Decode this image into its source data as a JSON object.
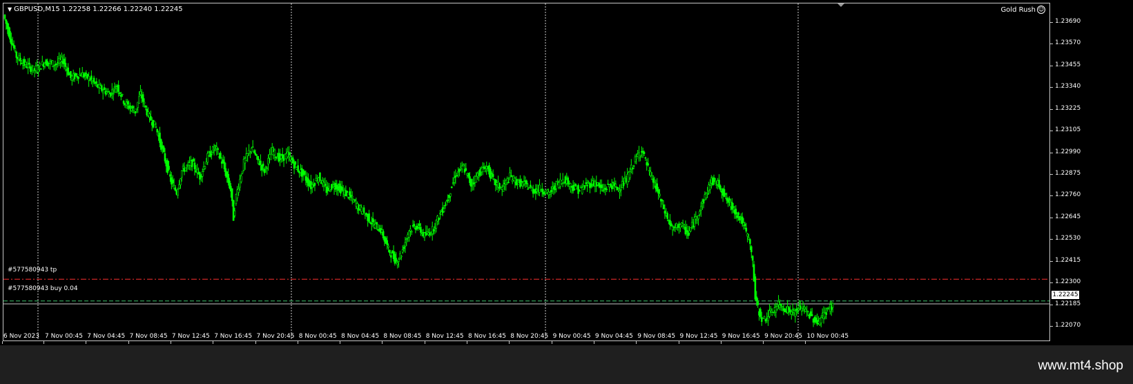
{
  "chart": {
    "symbol_label": "GBPUSD,M15",
    "ohlc_label": "1.22258 1.22266 1.22240 1.22245",
    "indicator_name": "Gold Rush",
    "bid_price": "1.22245",
    "candle_color": "#00ff00",
    "background_color": "#000000"
  },
  "orders": {
    "tp_label": "#577580943 tp",
    "tp_price": 1.2237,
    "tp_line_color": "#ff3030",
    "entry_label": "#577580943 buy 0.04",
    "entry_price": 1.2226,
    "entry_line_color": "#3cbf6a"
  },
  "price_axis": [
    "1.23690",
    "1.23570",
    "1.23455",
    "1.23340",
    "1.23225",
    "1.23105",
    "1.22990",
    "1.22875",
    "1.22760",
    "1.22645",
    "1.22530",
    "1.22415",
    "1.22300",
    "1.22185",
    "1.22070"
  ],
  "time_axis": [
    "6 Nov 2023",
    "7 Nov 00:45",
    "7 Nov 04:45",
    "7 Nov 08:45",
    "7 Nov 12:45",
    "7 Nov 16:45",
    "7 Nov 20:45",
    "8 Nov 00:45",
    "8 Nov 04:45",
    "8 Nov 08:45",
    "8 Nov 12:45",
    "8 Nov 16:45",
    "8 Nov 20:45",
    "9 Nov 00:45",
    "9 Nov 04:45",
    "9 Nov 08:45",
    "9 Nov 12:45",
    "9 Nov 16:45",
    "9 Nov 20:45",
    "10 Nov 00:45"
  ],
  "price_range": [
    1.2207,
    1.2375
  ],
  "day_separators": [
    "7 Nov",
    "8 Nov",
    "9 Nov",
    "10 Nov"
  ],
  "price_path": [
    [
      0,
      1.2371
    ],
    [
      2,
      1.2362
    ],
    [
      5,
      1.235
    ],
    [
      8,
      1.2346
    ],
    [
      12,
      1.2343
    ],
    [
      16,
      1.2347
    ],
    [
      20,
      1.2346
    ],
    [
      23,
      1.2348
    ],
    [
      26,
      1.2339
    ],
    [
      30,
      1.2341
    ],
    [
      33,
      1.2339
    ],
    [
      37,
      1.2334
    ],
    [
      41,
      1.2331
    ],
    [
      44,
      1.2335
    ],
    [
      47,
      1.2326
    ],
    [
      51,
      1.2322
    ],
    [
      53,
      1.2331
    ],
    [
      56,
      1.232
    ],
    [
      59,
      1.2314
    ],
    [
      62,
      1.23
    ],
    [
      65,
      1.2286
    ],
    [
      67,
      1.2281
    ],
    [
      69,
      1.2292
    ],
    [
      73,
      1.2296
    ],
    [
      76,
      1.2289
    ],
    [
      79,
      1.2299
    ],
    [
      82,
      1.2304
    ],
    [
      85,
      1.2295
    ],
    [
      88,
      1.2282
    ],
    [
      89,
      1.2268
    ],
    [
      90,
      1.2279
    ],
    [
      93,
      1.2296
    ],
    [
      96,
      1.2304
    ],
    [
      98,
      1.2298
    ],
    [
      101,
      1.2292
    ],
    [
      104,
      1.2302
    ],
    [
      107,
      1.2298
    ],
    [
      110,
      1.23
    ],
    [
      113,
      1.2294
    ],
    [
      116,
      1.229
    ],
    [
      119,
      1.2284
    ],
    [
      122,
      1.2289
    ],
    [
      125,
      1.2282
    ],
    [
      128,
      1.2285
    ],
    [
      131,
      1.2282
    ],
    [
      134,
      1.2279
    ],
    [
      137,
      1.2274
    ],
    [
      140,
      1.227
    ],
    [
      143,
      1.2265
    ],
    [
      146,
      1.2262
    ],
    [
      149,
      1.2252
    ],
    [
      152,
      1.2246
    ],
    [
      154,
      1.225
    ],
    [
      157,
      1.2262
    ],
    [
      160,
      1.2264
    ],
    [
      163,
      1.2259
    ],
    [
      166,
      1.2262
    ],
    [
      169,
      1.227
    ],
    [
      172,
      1.2278
    ],
    [
      175,
      1.229
    ],
    [
      178,
      1.2294
    ],
    [
      181,
      1.2285
    ],
    [
      184,
      1.2291
    ],
    [
      187,
      1.2294
    ],
    [
      190,
      1.2286
    ],
    [
      193,
      1.2283
    ],
    [
      196,
      1.2289
    ],
    [
      199,
      1.2286
    ],
    [
      202,
      1.2285
    ],
    [
      205,
      1.2282
    ],
    [
      208,
      1.2283
    ],
    [
      211,
      1.228
    ],
    [
      214,
      1.2285
    ],
    [
      217,
      1.2288
    ],
    [
      220,
      1.2284
    ],
    [
      223,
      1.2282
    ],
    [
      226,
      1.2285
    ],
    [
      229,
      1.2286
    ],
    [
      232,
      1.2282
    ],
    [
      235,
      1.2285
    ],
    [
      238,
      1.2283
    ],
    [
      241,
      1.2287
    ],
    [
      244,
      1.2296
    ],
    [
      247,
      1.2303
    ],
    [
      250,
      1.2291
    ],
    [
      253,
      1.2282
    ],
    [
      256,
      1.2271
    ],
    [
      259,
      1.2262
    ],
    [
      262,
      1.2265
    ],
    [
      265,
      1.226
    ],
    [
      268,
      1.2268
    ],
    [
      271,
      1.2277
    ],
    [
      274,
      1.2287
    ],
    [
      277,
      1.2285
    ],
    [
      280,
      1.2277
    ],
    [
      283,
      1.2272
    ],
    [
      286,
      1.2266
    ],
    [
      289,
      1.2255
    ],
    [
      290,
      1.2245
    ],
    [
      291,
      1.2228
    ],
    [
      292,
      1.2222
    ],
    [
      294,
      1.2216
    ],
    [
      297,
      1.222
    ],
    [
      300,
      1.2224
    ],
    [
      303,
      1.2222
    ],
    [
      306,
      1.222
    ],
    [
      309,
      1.2223
    ],
    [
      312,
      1.2219
    ],
    [
      315,
      1.2215
    ],
    [
      318,
      1.222
    ],
    [
      321,
      1.2224
    ]
  ]
}
